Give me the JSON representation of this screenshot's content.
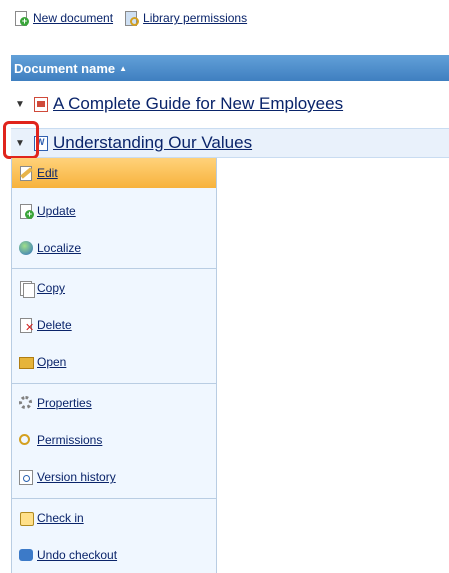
{
  "toolbar": {
    "new_document": "New document",
    "library_permissions": "Library permissions"
  },
  "grid": {
    "header": "Document name",
    "rows": [
      {
        "title": "A Complete Guide for New Employees"
      },
      {
        "title": "Understanding Our Values"
      }
    ]
  },
  "menu": {
    "edit": "Edit",
    "update": "Update",
    "localize": "Localize",
    "copy": "Copy",
    "delete": "Delete",
    "open": "Open",
    "properties": "Properties",
    "permissions": "Permissions",
    "version_history": "Version history",
    "check_in": "Check in",
    "undo_checkout": "Undo checkout"
  },
  "colors": {
    "header_bg": "#4f8fcf",
    "active_item": "#f7b23c",
    "highlight": "#e0241c"
  }
}
